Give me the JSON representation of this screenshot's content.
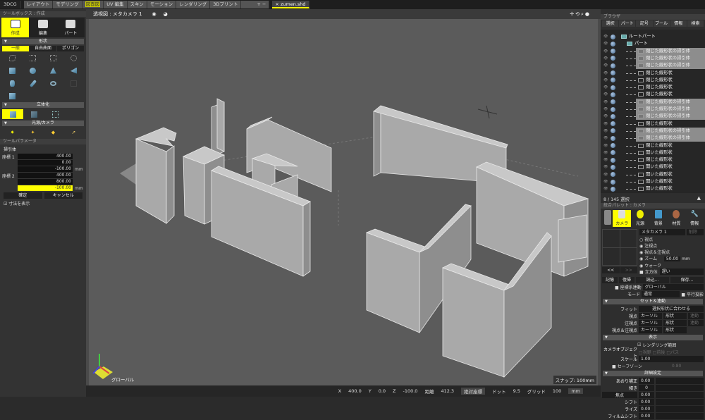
{
  "topbar": {
    "app": "3DCG",
    "tabs": [
      "レイアウト",
      "モデリング",
      "図面図",
      "UV 編集",
      "スキン",
      "モーション",
      "レンダリング",
      "3Dプリント"
    ],
    "selected_tab": 2,
    "plus_minus": "+ −",
    "file": "zumen.shd"
  },
  "toolbox": {
    "title": "ツールボックス : 作成",
    "modes": [
      "作成",
      "編集",
      "パート"
    ],
    "shape_section": "形状",
    "shape_tabs": [
      "一般",
      "自由曲面",
      "ポリゴン"
    ],
    "solid_section": "立体化",
    "light_section": "光源/カメラ"
  },
  "toolparam": {
    "title": "ツールパラメータ",
    "group": "掃引体",
    "coord1": "座標 1",
    "coord2": "座標 2",
    "values": [
      "400.00",
      "0.00",
      "-100.00",
      "400.00",
      "800.00",
      "-100.00"
    ],
    "unit": "mm",
    "ok": "確定",
    "cancel": "キャンセル",
    "show_dims": "寸法を表示"
  },
  "viewport": {
    "title": "透視図 : メタカメラ 1",
    "snap": "スナップ: 100mm",
    "axis_label": "グローバル",
    "colors": {
      "background": "#5b5b5b",
      "wall_front": "#a9a9a9",
      "wall_top": "#c8c8c8",
      "wall_side": "#8e8e8e"
    }
  },
  "status": {
    "x_label": "X",
    "x": "400.0",
    "y_label": "Y",
    "y": "0.0",
    "z_label": "Z",
    "z": "-100.0",
    "dist_label": "距離",
    "dist": "412.3",
    "coord_mode": "絶対座標",
    "dot_label": "ドット",
    "dot": "9.5",
    "grid_label": "グリッド",
    "grid": "100",
    "unit": "mm"
  },
  "browser": {
    "title": "ブラウザ",
    "tabs": [
      "選択",
      "パート",
      "記号",
      "ブール",
      "情報",
      "検索"
    ],
    "selection": "8 / 145 選択",
    "items": [
      {
        "name": "ルートパート",
        "level": 0,
        "sel": false,
        "type": "part"
      },
      {
        "name": "パート",
        "level": 1,
        "sel": false,
        "type": "part"
      },
      {
        "name": "閉じた線形状の掃引体",
        "level": 2,
        "sel": true,
        "type": "sweep"
      },
      {
        "name": "閉じた線形状の掃引体",
        "level": 2,
        "sel": true,
        "type": "sweep"
      },
      {
        "name": "閉じた線形状の掃引体",
        "level": 2,
        "sel": true,
        "type": "sweep"
      },
      {
        "name": "閉じた線形状",
        "level": 2,
        "sel": false,
        "type": "line"
      },
      {
        "name": "閉じた線形状",
        "level": 2,
        "sel": false,
        "type": "line"
      },
      {
        "name": "閉じた線形状",
        "level": 2,
        "sel": false,
        "type": "line"
      },
      {
        "name": "閉じた線形状",
        "level": 2,
        "sel": false,
        "type": "line"
      },
      {
        "name": "閉じた線形状の掃引体",
        "level": 2,
        "sel": true,
        "type": "sweep"
      },
      {
        "name": "閉じた線形状の掃引体",
        "level": 2,
        "sel": true,
        "type": "sweep"
      },
      {
        "name": "閉じた線形状の掃引体",
        "level": 2,
        "sel": true,
        "type": "sweep"
      },
      {
        "name": "閉じた線形状",
        "level": 2,
        "sel": false,
        "type": "line"
      },
      {
        "name": "閉じた線形状の掃引体",
        "level": 2,
        "sel": true,
        "type": "sweep"
      },
      {
        "name": "閉じた線形状の掃引体",
        "level": 2,
        "sel": true,
        "type": "sweep"
      },
      {
        "name": "閉じた線形状",
        "level": 2,
        "sel": false,
        "type": "line"
      },
      {
        "name": "開いた線形状",
        "level": 2,
        "sel": false,
        "type": "line"
      },
      {
        "name": "閉じた線形状",
        "level": 2,
        "sel": false,
        "type": "line"
      },
      {
        "name": "開いた線形状",
        "level": 2,
        "sel": false,
        "type": "line"
      },
      {
        "name": "開いた線形状",
        "level": 2,
        "sel": false,
        "type": "line"
      },
      {
        "name": "開いた線形状",
        "level": 2,
        "sel": false,
        "type": "line"
      },
      {
        "name": "開いた線形状",
        "level": 2,
        "sel": false,
        "type": "line"
      }
    ]
  },
  "palette": {
    "title": "統合パレット : カメラ",
    "tabs": [
      "カメラ",
      "光源",
      "背景",
      "材質",
      "情報"
    ],
    "camera_name": "メタカメラ 1",
    "delete": "削除",
    "options": [
      "視点",
      "注視点",
      "視点＆注視点",
      "ズーム",
      "ウォーク"
    ],
    "zoom_value": "50.00",
    "unit": "mm",
    "cube": "立方体",
    "speed": "遅い",
    "prev": "<<",
    "next": ">>",
    "remember": "記憶",
    "restore": "復帰",
    "load": "読込...",
    "save": "保存...",
    "coord_link": "座標系連動",
    "coord_value": "グローバル",
    "mode_label": "モード",
    "mode_value": "通常",
    "parallel": "平行投影",
    "set_section": "セット＆連動",
    "fit": "フィット",
    "fit_value": "選択形状に合わせる",
    "rows": [
      "視点",
      "注視点",
      "視点＆注視点"
    ],
    "cursor": "カーソル",
    "shape": "形状",
    "link": "連動",
    "display_section": "表示",
    "render_range": "レンダリング範囲",
    "cam_obj": "カメラオブジェクト",
    "cam_obj_opts": [
      "視野",
      "前後",
      "パス"
    ],
    "scale_label": "スケール",
    "scale": "1.00",
    "safe_zone": "セーフゾーン",
    "safe_value": "0.80",
    "detail_section": "詳細設定",
    "details": [
      {
        "label": "あおり補正",
        "value": "0.00"
      },
      {
        "label": "傾き",
        "value": "0"
      },
      {
        "label": "焦点",
        "value": "0.00"
      },
      {
        "label": "シフト",
        "value": "0.00"
      },
      {
        "label": "ライズ",
        "value": "0.00"
      },
      {
        "label": "フィルムシフト",
        "value": "0.00"
      }
    ]
  }
}
